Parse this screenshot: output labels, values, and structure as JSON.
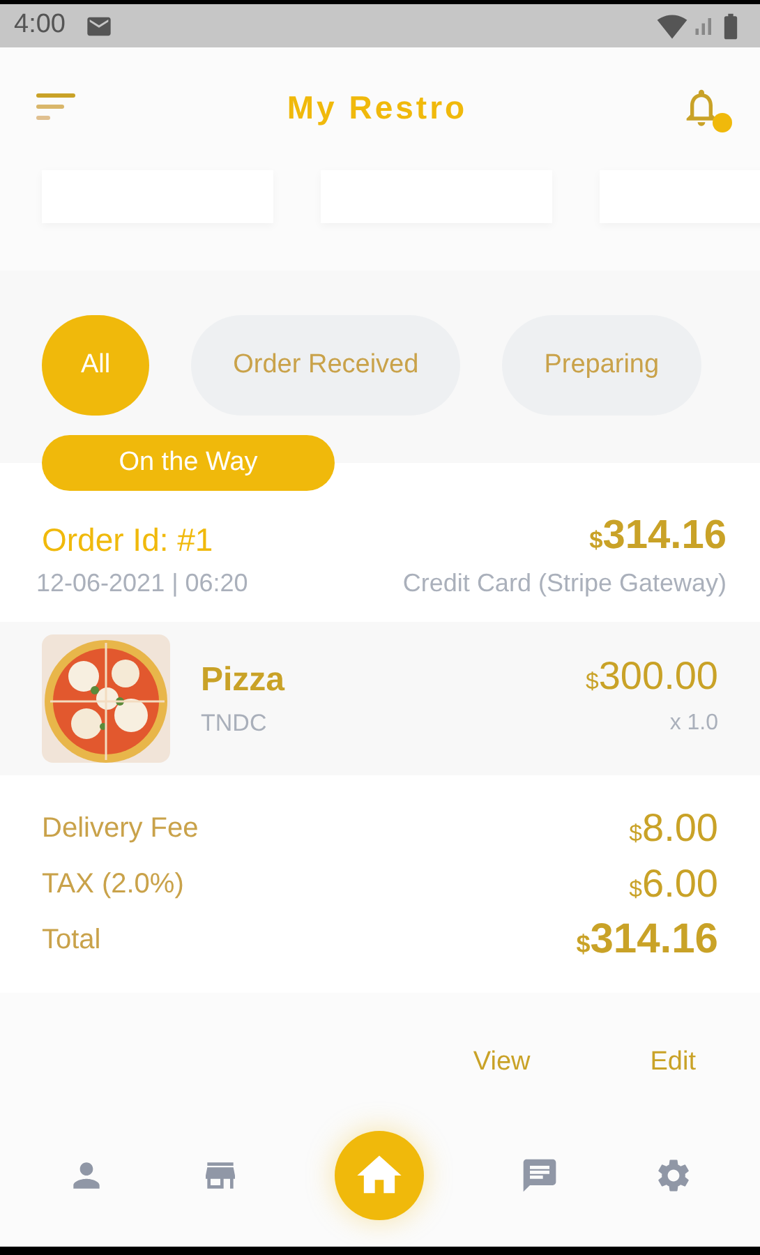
{
  "status_bar": {
    "time": "4:00"
  },
  "header": {
    "title": "My Restro",
    "notification_badge": true
  },
  "filters": [
    {
      "label": "All",
      "selected": true
    },
    {
      "label": "Order Received",
      "selected": false
    },
    {
      "label": "Preparing",
      "selected": false
    }
  ],
  "order": {
    "status": "On the Way",
    "id": "Order Id: #1",
    "datetime": "12-06-2021 | 06:20",
    "total": "$314.16",
    "payment": "Credit Card (Stripe Gateway)",
    "items": [
      {
        "kind": "picture",
        "name": "Pizza",
        "code": "TNDC",
        "price": "$300.00",
        "quantity": "x 1.0"
      }
    ],
    "summary": [
      {
        "label": "Delivery Fee",
        "value": "$8.00",
        "kind": "line"
      },
      {
        "label": "TAX (2.0%)",
        "value": "$6.00",
        "kind": "line"
      },
      {
        "label": "Total",
        "value": "$314.16",
        "kind": "total"
      }
    ],
    "actions": [
      "View",
      "Edit"
    ]
  },
  "bottom_nav": [
    {
      "selected": false
    },
    {
      "selected": false
    },
    {
      "selected": true
    },
    {
      "selected": false
    },
    {
      "selected": false
    }
  ]
}
